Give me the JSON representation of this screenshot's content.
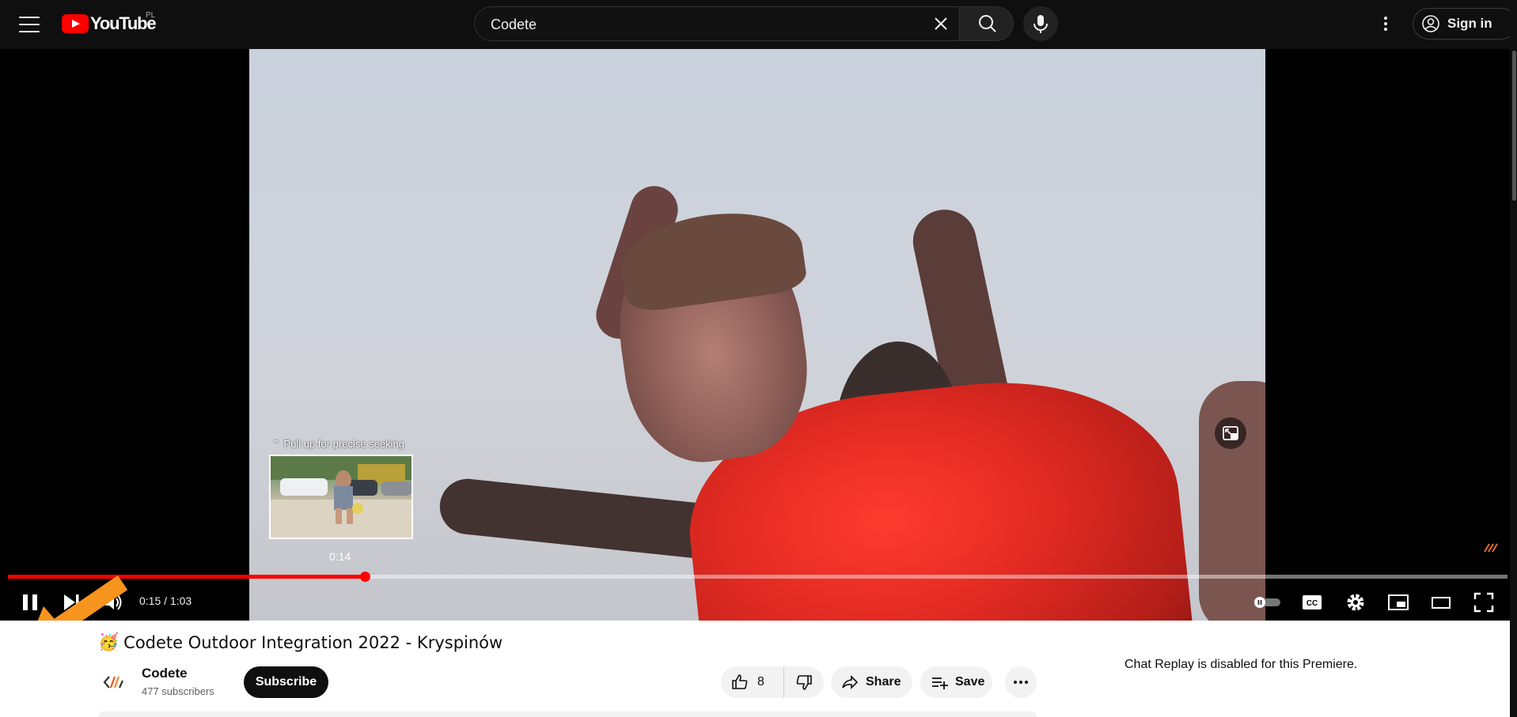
{
  "masthead": {
    "logo_text": "YouTube",
    "country_code": "PL",
    "search_value": "Codete",
    "search_placeholder": "Search",
    "signin_label": "Sign in"
  },
  "player": {
    "preview_hint": "Pull up for precise seeking",
    "preview_time": "0:14",
    "current_time": "0:15",
    "duration": "1:03",
    "time_display": "0:15 / 1:03",
    "progress_fraction": 0.2381,
    "accent_color": "#ff0000"
  },
  "video_info": {
    "title_emoji": "🥳",
    "title": "Codete Outdoor Integration 2022 - Kryspinów",
    "channel_name": "Codete",
    "subscribers": "477 subscribers",
    "subscribe_label": "Subscribe",
    "like_count": "8",
    "share_label": "Share",
    "save_label": "Save"
  },
  "chat": {
    "note": "Chat Replay is disabled for this Premiere."
  },
  "icons": [
    "menu-icon",
    "youtube-logo-icon",
    "clear-icon",
    "search-icon",
    "mic-icon",
    "more-vert-icon",
    "account-icon",
    "pip-expand-icon",
    "pause-icon",
    "next-icon",
    "volume-icon",
    "autoplay-toggle-icon",
    "captions-icon",
    "settings-icon",
    "miniplayer-icon",
    "theater-icon",
    "fullscreen-icon",
    "like-icon",
    "dislike-icon",
    "share-icon",
    "save-icon",
    "more-horiz-icon"
  ]
}
